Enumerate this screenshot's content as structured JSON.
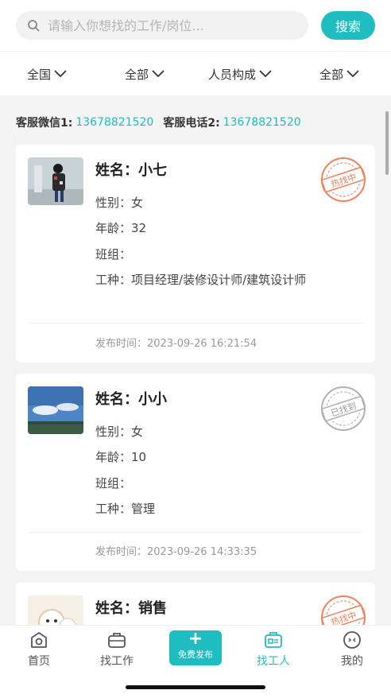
{
  "search": {
    "placeholder": "请输入你想找的工作/岗位...",
    "button": "搜索"
  },
  "filters": [
    "全国",
    "全部",
    "人员构成",
    "全部"
  ],
  "contact": {
    "wechat_label": "客服微信1:",
    "wechat": "13678821520",
    "phone_label": "客服电话2:",
    "phone": "13678821520"
  },
  "labels": {
    "name": "姓名：",
    "gender": "性别：",
    "age": "年龄：",
    "team": "班组：",
    "trade": "工种：",
    "time": "发布时间："
  },
  "cards": [
    {
      "name": "小七",
      "gender": "女",
      "age": "32",
      "team": "",
      "trade": "项目经理/装修设计师/建筑设计师",
      "time": "2023-09-26 16:21:54",
      "status": "热找中",
      "status_color": "#f0825a"
    },
    {
      "name": "小小",
      "gender": "女",
      "age": "10",
      "team": "",
      "trade": "管理",
      "time": "2023-09-26 14:33:35",
      "status": "已找到",
      "status_color": "#b0b0b0"
    },
    {
      "name": "销售",
      "status": "热找中",
      "status_color": "#f0825a"
    }
  ],
  "tabs": {
    "home": "首页",
    "find_job": "找工作",
    "publish": "免费发布",
    "find_worker": "找工人",
    "mine": "我的"
  },
  "colors": {
    "accent": "#1fbdc1",
    "hot": "#f0825a",
    "found": "#b0b0b0"
  }
}
